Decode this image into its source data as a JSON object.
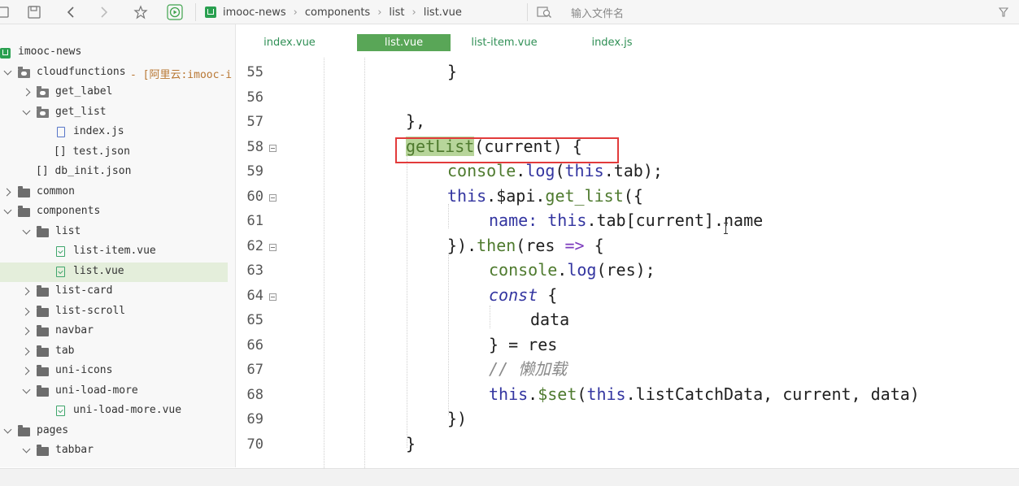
{
  "breadcrumb": {
    "items": [
      "imooc-news",
      "components",
      "list",
      "list.vue"
    ]
  },
  "search": {
    "placeholder": "输入文件名"
  },
  "sidebar": {
    "items": [
      {
        "label": "imooc-news"
      },
      {
        "label": "cloudfunctions",
        "suffix": "- [阿里云:imooc-i"
      },
      {
        "label": "get_label"
      },
      {
        "label": "get_list"
      },
      {
        "label": "index.js"
      },
      {
        "label": "[] test.json"
      },
      {
        "label": "[] db_init.json"
      },
      {
        "label": "common"
      },
      {
        "label": "components"
      },
      {
        "label": "list"
      },
      {
        "label": "list-item.vue"
      },
      {
        "label": "list.vue"
      },
      {
        "label": "list-card"
      },
      {
        "label": "list-scroll"
      },
      {
        "label": "navbar"
      },
      {
        "label": "tab"
      },
      {
        "label": "uni-icons"
      },
      {
        "label": "uni-load-more"
      },
      {
        "label": "uni-load-more.vue"
      },
      {
        "label": "pages"
      },
      {
        "label": "tabbar"
      }
    ]
  },
  "tabs": [
    {
      "label": "index.vue"
    },
    {
      "label": "list.vue"
    },
    {
      "label": "list-item.vue"
    },
    {
      "label": "index.js"
    }
  ],
  "editor": {
    "line_numbers": [
      "55",
      "56",
      "57",
      "58",
      "59",
      "60",
      "61",
      "62",
      "63",
      "64",
      "65",
      "66",
      "67",
      "68",
      "69",
      "70"
    ],
    "code": {
      "l55": "}",
      "l57": "},",
      "l58_fn": "getList",
      "l58_rest": "(current) {",
      "l59_a": "console",
      "l59_b": ".",
      "l59_c": "log",
      "l59_d": "(",
      "l59_e": "this",
      "l59_f": ".tab);",
      "l60_a": "this",
      "l60_b": ".$api.",
      "l60_c": "get_list",
      "l60_d": "({",
      "l61_a": "name:",
      "l61_b": " this",
      "l61_c": ".tab[current].name",
      "l62_a": "}).",
      "l62_b": "then",
      "l62_c": "(res ",
      "l62_d": "=>",
      "l62_e": " {",
      "l63_a": "console",
      "l63_b": ".",
      "l63_c": "log",
      "l63_d": "(res);",
      "l64_a": "const",
      "l64_b": " {",
      "l65": "data",
      "l66": "} = res",
      "l67": "// 懒加载",
      "l68_a": "this",
      "l68_b": ".",
      "l68_c": "$set",
      "l68_d": "(",
      "l68_e": "this",
      "l68_f": ".listCatchData, current, data)",
      "l69": "})",
      "l70": "}"
    }
  },
  "colors": {
    "accent_green": "#59a657",
    "selection_green": "#e4eedb",
    "highlight_box_red": "#e23b3b",
    "keyword_blue": "#3335a0",
    "function_green": "#4e7a2e"
  }
}
